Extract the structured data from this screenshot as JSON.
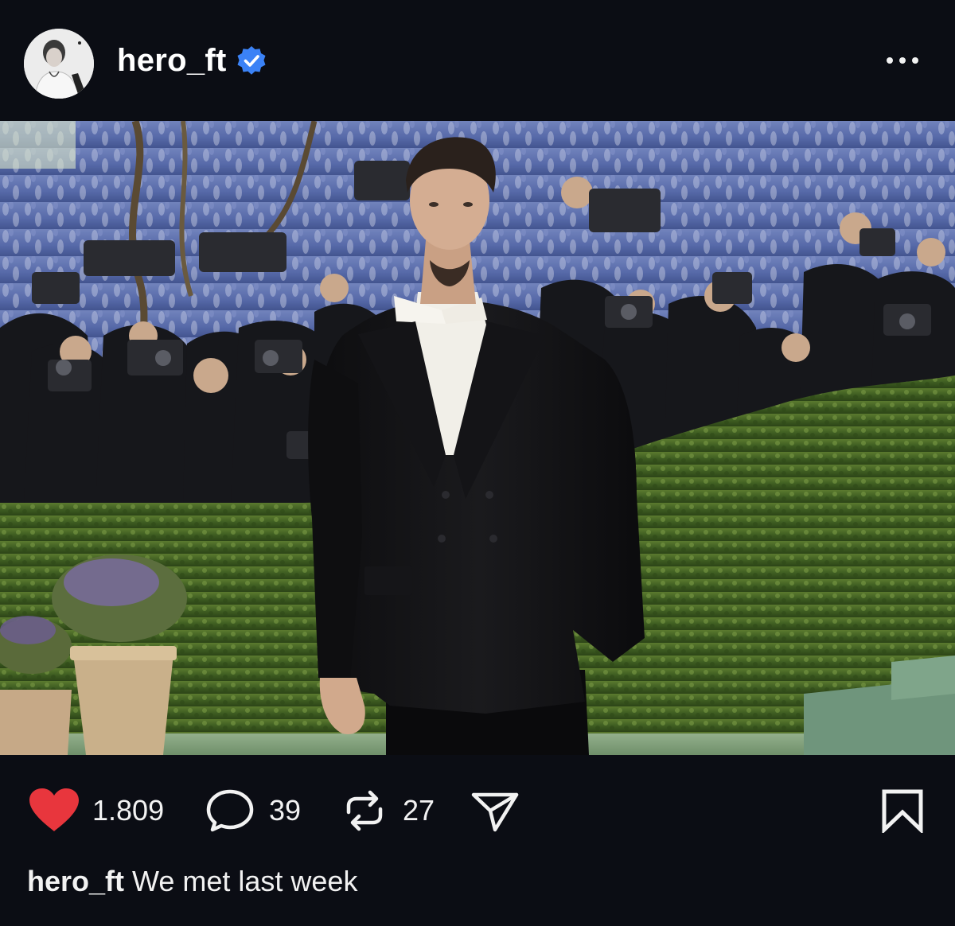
{
  "post": {
    "username": "hero_ft",
    "verified": true,
    "icons": {
      "avatar": "profile-photo",
      "verified": "verified-badge-icon",
      "more": "more-dots-icon",
      "like": "heart-icon",
      "comment": "comment-bubble-icon",
      "repost": "repost-arrows-icon",
      "share": "paper-plane-icon",
      "save": "bookmark-icon"
    },
    "colors": {
      "background": "#0b0d14",
      "like": "#e8363d",
      "verified": "#3b82f6",
      "text": "#f2f2f2"
    }
  },
  "actions": {
    "likes": "1.809",
    "comments": "39",
    "reposts": "27"
  },
  "caption": {
    "username": "hero_ft",
    "text": "We met last week"
  }
}
